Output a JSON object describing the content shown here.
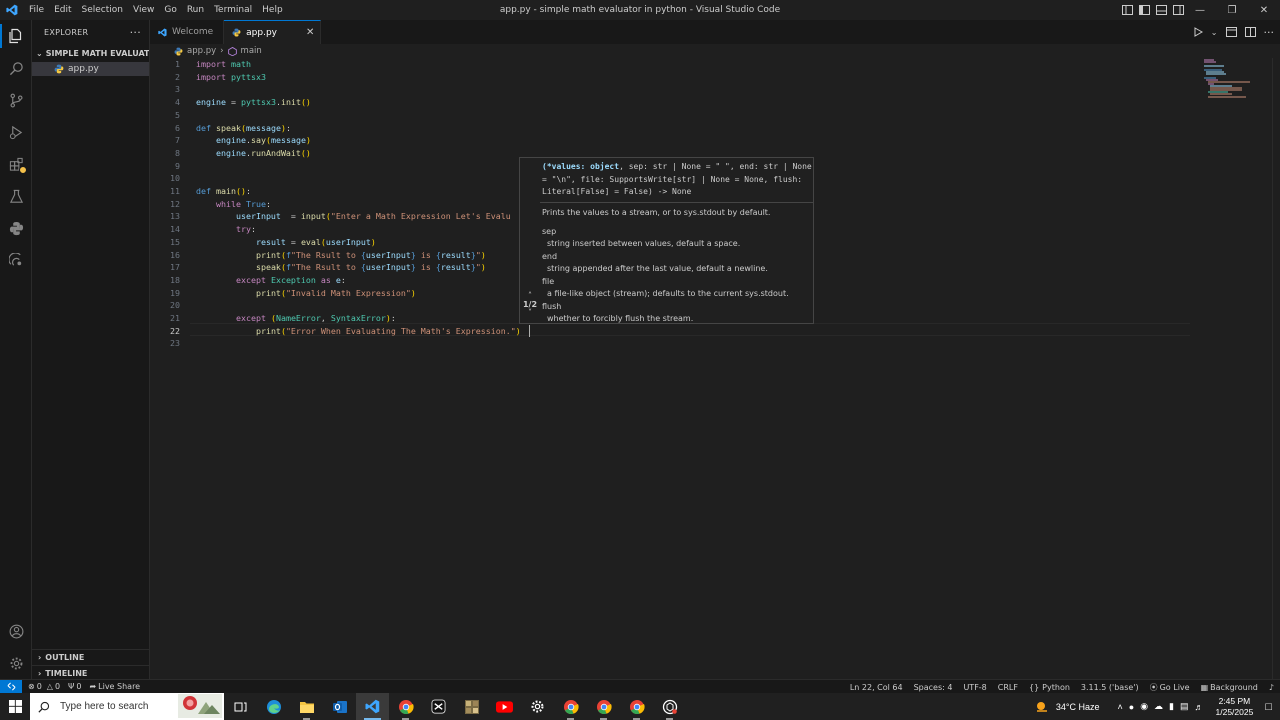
{
  "window": {
    "title": "app.py - simple math evaluator in python - Visual Studio Code",
    "menu": [
      "File",
      "Edit",
      "Selection",
      "View",
      "Go",
      "Run",
      "Terminal",
      "Help"
    ]
  },
  "sidebar": {
    "header": "EXPLORER",
    "folder": "SIMPLE MATH EVALUATOR I...",
    "file": "app.py",
    "outline": "OUTLINE",
    "timeline": "TIMELINE"
  },
  "tabs": [
    {
      "label": "Welcome",
      "active": false
    },
    {
      "label": "app.py",
      "active": true
    }
  ],
  "breadcrumb": {
    "file": "app.py",
    "symbol": "main"
  },
  "editor": {
    "current_line": 22,
    "lines": [
      {
        "n": "1",
        "html": "<span class='kw'>import</span> <span class='mod'>math</span>"
      },
      {
        "n": "2",
        "html": "<span class='kw'>import</span> <span class='mod'>pyttsx3</span>"
      },
      {
        "n": "3",
        "html": ""
      },
      {
        "n": "4",
        "html": "<span class='var'>engine</span> = <span class='mod'>pyttsx3</span>.<span class='fn'>init</span><span class='br'>()</span>"
      },
      {
        "n": "5",
        "html": ""
      },
      {
        "n": "6",
        "html": "<span class='kb'>def</span> <span class='fn'>speak</span><span class='br'>(</span><span class='var'>message</span><span class='br'>)</span>:"
      },
      {
        "n": "7",
        "html": "    <span class='var'>engine</span>.<span class='fn'>say</span><span class='br'>(</span><span class='var'>message</span><span class='br'>)</span>"
      },
      {
        "n": "8",
        "html": "    <span class='var'>engine</span>.<span class='fn'>runAndWait</span><span class='br'>()</span>"
      },
      {
        "n": "9",
        "html": ""
      },
      {
        "n": "10",
        "html": ""
      },
      {
        "n": "11",
        "html": "<span class='kb'>def</span> <span class='fn'>main</span><span class='br'>()</span>:"
      },
      {
        "n": "12",
        "html": "    <span class='kw'>while</span> <span class='kb'>True</span>:"
      },
      {
        "n": "13",
        "html": "        <span class='var'>userInput</span>  = <span class='fn'>input</span><span class='br'>(</span><span class='str'>\"Enter a Math Expression Let's Evalu</span>"
      },
      {
        "n": "14",
        "html": "        <span class='kw'>try</span>:"
      },
      {
        "n": "15",
        "html": "            <span class='var'>result</span> = <span class='fn'>eval</span><span class='br'>(</span><span class='var'>userInput</span><span class='br'>)</span>"
      },
      {
        "n": "16",
        "html": "            <span class='fn'>print</span><span class='br'>(</span><span class='kb'>f</span><span class='str'>\"The Rsult to </span><span class='kb'>{</span><span class='var'>userInput</span><span class='kb'>}</span><span class='str'> is </span><span class='kb'>{</span><span class='var'>result</span><span class='kb'>}</span><span class='str'>\"</span><span class='br'>)</span>"
      },
      {
        "n": "17",
        "html": "            <span class='fn'>speak</span><span class='br'>(</span><span class='kb'>f</span><span class='str'>\"The Rsult to </span><span class='kb'>{</span><span class='var'>userInput</span><span class='kb'>}</span><span class='str'> is </span><span class='kb'>{</span><span class='var'>result</span><span class='kb'>}</span><span class='str'>\"</span><span class='br'>)</span>"
      },
      {
        "n": "18",
        "html": "        <span class='kw'>except</span> <span class='mod'>Exception</span> <span class='kw'>as</span> <span class='var'>e</span>:"
      },
      {
        "n": "19",
        "html": "            <span class='fn'>print</span><span class='br'>(</span><span class='str'>\"Invalid Math Expression\"</span><span class='br'>)</span>"
      },
      {
        "n": "20",
        "html": ""
      },
      {
        "n": "21",
        "html": "        <span class='kw'>except</span> <span class='br'>(</span><span class='mod'>NameError</span>, <span class='mod'>SyntaxError</span><span class='br'>)</span>:"
      },
      {
        "n": "22",
        "html": "            <span class='fn'>print</span><span class='br'>(</span><span class='str'>\"Error When Evaluating The Math's Expression.\"</span><span class='br'>)</span>"
      },
      {
        "n": "23",
        "html": ""
      }
    ]
  },
  "signature_help": {
    "counter": "1/2",
    "signature": "(*values: object, sep: str | None = \" \", end: str | None = \"\\n\", file: SupportsWrite[str] | None = None, flush: Literal[False] = False) -> None",
    "summary": "Prints the values to a stream, or to sys.stdout by default.",
    "params": [
      {
        "name": "sep",
        "desc": "string inserted between values, default a space."
      },
      {
        "name": "end",
        "desc": "string appended after the last value, default a newline."
      },
      {
        "name": "file",
        "desc": "a file-like object (stream); defaults to the current sys.stdout."
      },
      {
        "name": "flush",
        "desc": "whether to forcibly flush the stream."
      }
    ]
  },
  "statusbar": {
    "errors": "0",
    "warnings": "0",
    "ports": "0",
    "live_share": "Live Share",
    "position": "Ln 22, Col 64",
    "spaces": "Spaces: 4",
    "encoding": "UTF-8",
    "eol": "CRLF",
    "language": "Python",
    "interpreter": "3.11.5 ('base')",
    "go_live": "Go Live",
    "background": "Background"
  },
  "taskbar": {
    "search_placeholder": "Type here to search",
    "weather": "34°C  Haze",
    "time": "2:45 PM",
    "date": "1/25/2025"
  },
  "colors": {
    "accent": "#0078d4",
    "keyword": "#c586c0",
    "function": "#dcdcaa",
    "string": "#ce9178"
  }
}
